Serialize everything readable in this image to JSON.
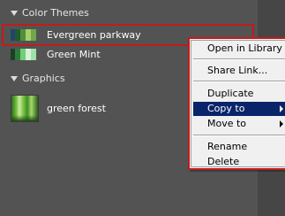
{
  "sections": {
    "color_themes": {
      "title": "Color Themes",
      "items": [
        {
          "name": "Evergreen parkway",
          "swatch": [
            "#23446e",
            "#1e5e2c",
            "#4f8f3c",
            "#a8cf6a",
            "#6fa84a"
          ]
        },
        {
          "name": "Green Mint",
          "swatch": [
            "#1d3f2a",
            "#2f7a3a",
            "#6fcf7a",
            "#d8f2da",
            "#9fe0a6"
          ]
        }
      ]
    },
    "graphics": {
      "title": "Graphics",
      "items": [
        {
          "name": "green forest"
        }
      ]
    }
  },
  "context_menu": {
    "items": [
      {
        "label": "Open in Library"
      },
      {
        "label": "Share Link..."
      },
      {
        "label": "Duplicate"
      },
      {
        "label": "Copy to",
        "active": true,
        "submenu": true
      },
      {
        "label": "Move to",
        "submenu": true
      },
      {
        "label": "Rename"
      },
      {
        "label": "Delete"
      }
    ]
  },
  "colors": {
    "panel_bg": "#535353",
    "highlight_outline": "#c21b1b",
    "menu_bg": "#f0f0f0",
    "menu_active_bg": "#0a246a"
  }
}
